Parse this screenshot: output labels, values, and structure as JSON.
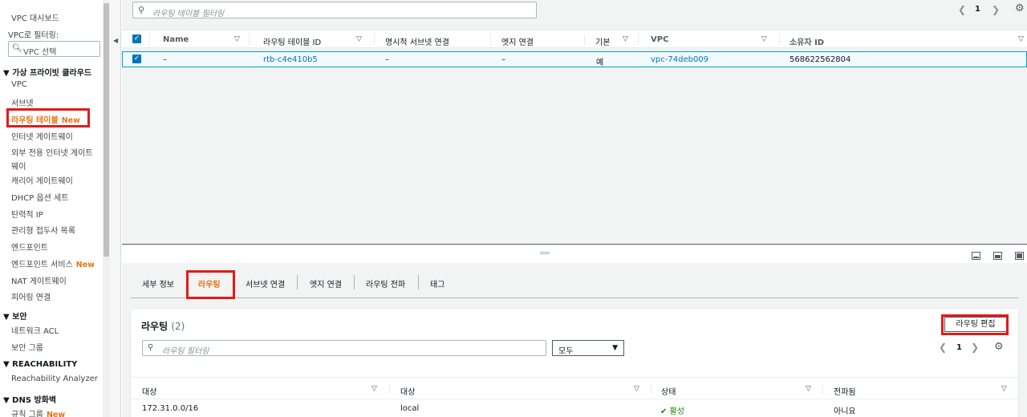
{
  "sidebar": {
    "dashboard": "VPC 대시보드",
    "filter_label": "VPC로 필터링:",
    "vpc_select_placeholder": "VPC 선택",
    "section_vpc": "▼ 가상 프라이빗 클라우드",
    "items_vpc": [
      "VPC",
      "서브넷"
    ],
    "active_item": "라우팅 테이블",
    "new_badge": "New",
    "igw": "인터넷 게이트웨이",
    "egress_igw_line1": "외부 전용 인터넷 게이트",
    "egress_igw_line2": "웨이",
    "carrier_gw": "캐리어 게이트웨이",
    "dhcp": "DHCP 옵션 세트",
    "eip": "탄력적 IP",
    "managed_prefix": "관리형 접두사 목록",
    "endpoints": "엔드포인트",
    "endpoint_services": "엔드포인트 서비스",
    "nat": "NAT 게이트웨이",
    "peering": "피어링 연결",
    "section_security": "▼ 보안",
    "nacl": "네트워크 ACL",
    "sg": "보안 그룹",
    "section_reach": "▼ REACHABILITY",
    "reach_analyzer": "Reachability Analyzer",
    "section_dns": "▼ DNS 방화벽",
    "rule_groups": "규칙 그룹"
  },
  "top": {
    "filter_placeholder": "라우팅 테이블 필터링",
    "page": "1",
    "columns": [
      "Name",
      "라우팅 테이블 ID",
      "명시적 서브넷 연결",
      "엣지 연결",
      "기본",
      "VPC",
      "소유자 ID"
    ],
    "row": {
      "name": "–",
      "rtb_id": "rtb-c4e410b5",
      "explicit_subnet": "–",
      "edge": "–",
      "main": "예",
      "vpc": "vpc-74deb009",
      "owner": "568622562804"
    }
  },
  "bottom": {
    "tabs": [
      "세부 정보",
      "라우팅",
      "서브넷 연결",
      "엣지 연결",
      "라우팅 전파",
      "태그"
    ],
    "active_tab": "라우팅",
    "card_title": "라우팅",
    "card_count": "(2)",
    "edit_button": "라우팅 편집",
    "route_filter_placeholder": "라우팅 필터링",
    "dropdown_value": "모두",
    "page": "1",
    "columns": [
      "대상",
      "대상",
      "상태",
      "전파됨"
    ],
    "routes": [
      {
        "destination": "172.31.0.0/16",
        "target": "local",
        "status": "활성",
        "propagated": "아니요"
      }
    ]
  },
  "colors": {
    "accent": "#ec7211",
    "link": "#0073bb",
    "highlight_box": "#e01b1b",
    "active_green": "#1d8102"
  }
}
